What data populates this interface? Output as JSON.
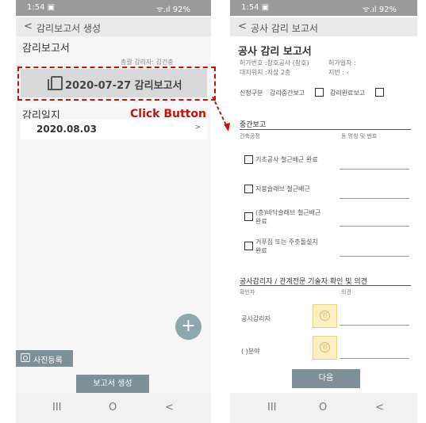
{
  "left_screen": {
    "status": {
      "time": "1:54 ▣",
      "signal": "ᯤ.ıl 92%"
    },
    "appbar": {
      "back_icon": "chevron-left-icon",
      "title": "감리보고서 생성"
    },
    "report_section": {
      "title": "감리보고서",
      "supervisor": "총괄 감리자: 김건충"
    },
    "report_button": {
      "icon": "document-icon",
      "label": "2020-07-27 감리보고서"
    },
    "annotation": {
      "text": "Click Button",
      "color": "#c0140c"
    },
    "daily_section": {
      "title": "감리일지"
    },
    "daily_items": [
      {
        "date": "2020.08.03",
        "chevron": ">"
      }
    ],
    "fab": {
      "icon": "plus-icon",
      "label": "+"
    },
    "photo_button": {
      "icon": "camera-icon",
      "label": "사진등록"
    },
    "create_button": {
      "label": "보고서 생성"
    },
    "nav": {
      "recent": "III",
      "home": "O",
      "back": "<"
    }
  },
  "right_screen": {
    "status": {
      "time": "1:54 ▣",
      "signal": "ᯤ.ıl 92%"
    },
    "appbar": {
      "back_icon": "chevron-left-icon",
      "title": "공사 감리 보고서"
    },
    "heading": "공사 감리 보고서",
    "permit_no": "허가번호 :창호공사 (창호)",
    "permit_date": "허가일자 :",
    "site": "대지위치 :지상 2층",
    "lot": "지번 :   -",
    "application_type": "신청구분",
    "interim_report": "감리중간보고",
    "final_report": "감리완료보고",
    "midterm": {
      "title": "중간보고",
      "col_process": "건축공정",
      "col_building": "동 명칭 및 번호",
      "items": [
        {
          "line1": "기초공사 철근배근 완료",
          "line2": ""
        },
        {
          "line1": "지붕슬래브 철근배근",
          "line2": ""
        },
        {
          "line1": "(층)바닥슬래브 철근배근",
          "line2": "완료"
        },
        {
          "line1": "거푸집 또는 주춧돌설치",
          "line2": "완료"
        }
      ]
    },
    "opinion": {
      "title": "공사감리자 / 관계전문 기술자 확인 및 의견",
      "col_confirmer": "확인자",
      "col_opinion": "의견",
      "rows": [
        {
          "label": "공사감리자",
          "stamp": "인"
        },
        {
          "label": "(     )분야",
          "stamp": "인"
        }
      ]
    },
    "next_button": "다음",
    "nav": {
      "recent": "III",
      "home": "O",
      "back": "<"
    }
  }
}
